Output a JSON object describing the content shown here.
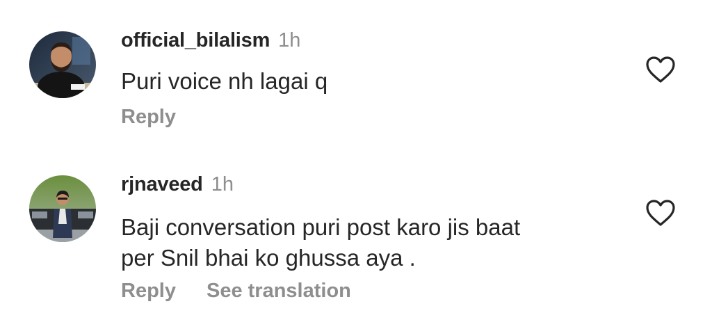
{
  "comments": [
    {
      "username": "official_bilalism",
      "time": "1h",
      "text": "Puri voice nh lagai q",
      "reply_label": "Reply",
      "avatar_icon": "profile-photo-man-desk",
      "like_icon": "heart-outline-icon"
    },
    {
      "username": "rjnaveed",
      "time": "1h",
      "text_lines": [
        "Baji conversation puri post karo jis baat",
        "per Snil bhai ko ghussa aya ."
      ],
      "reply_label": "Reply",
      "translation_label": "See translation",
      "avatar_icon": "profile-photo-man-car",
      "like_icon": "heart-outline-icon"
    }
  ],
  "colors": {
    "primary_text": "#262626",
    "secondary_text": "#8e8e8e",
    "background": "#ffffff"
  }
}
